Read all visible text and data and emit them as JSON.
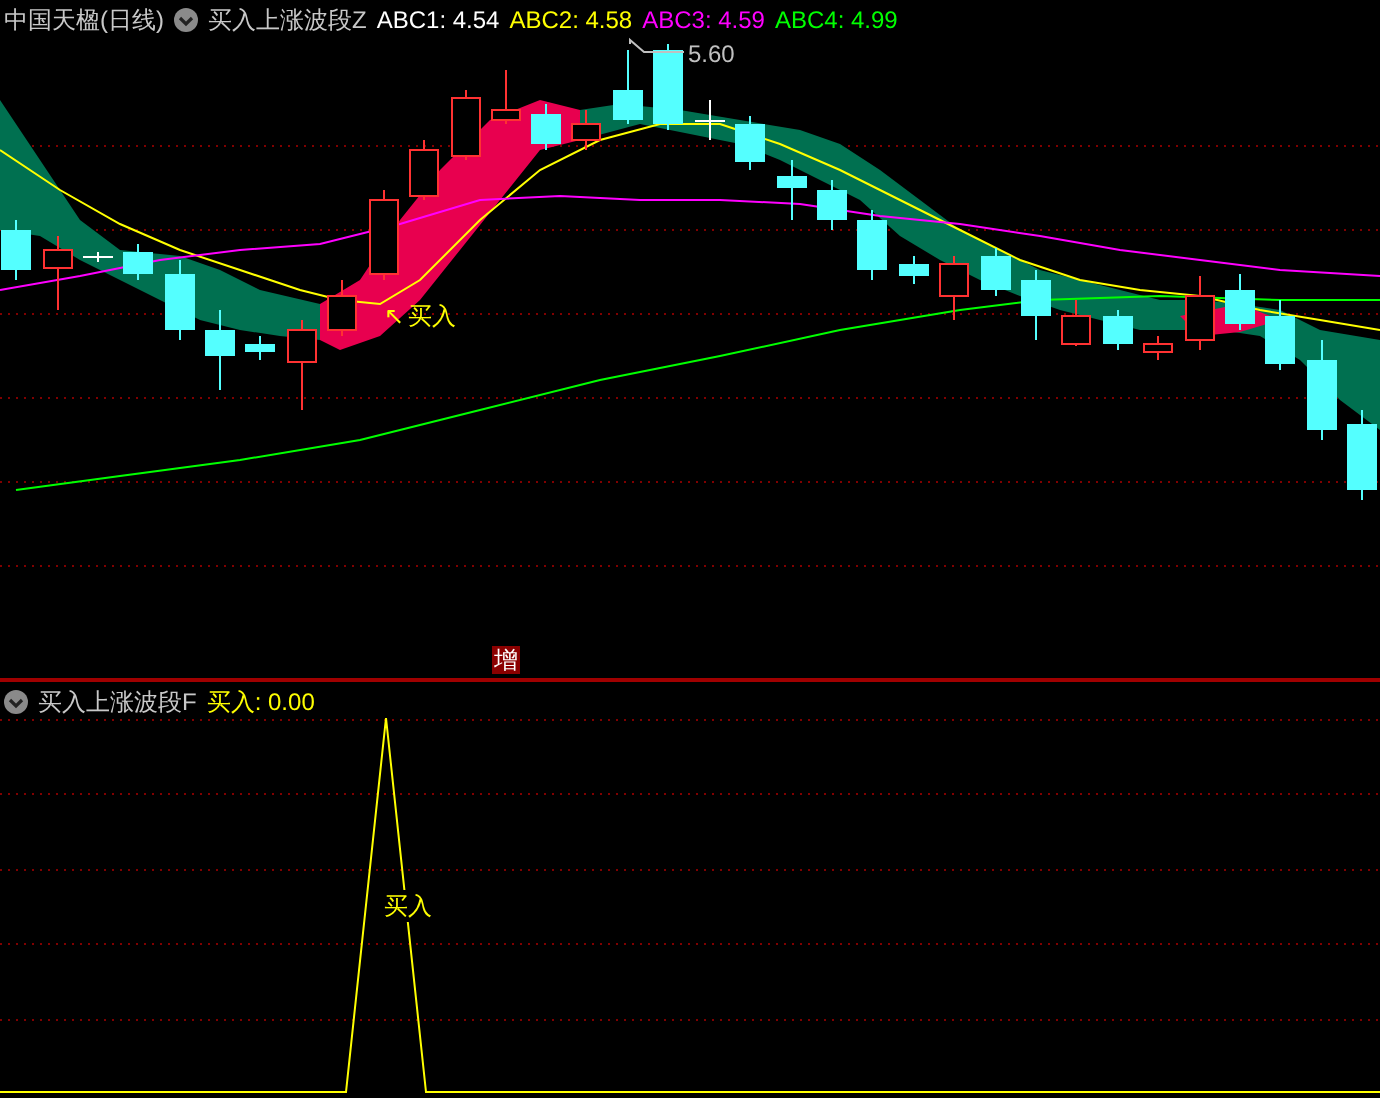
{
  "main_panel": {
    "title": "中国天楹(日线)",
    "indicator": "买入上涨波段Z",
    "values": [
      {
        "label": "ABC1:",
        "value": "4.54",
        "color": "#ffffff"
      },
      {
        "label": "ABC2:",
        "value": "4.58",
        "color": "#ffff00"
      },
      {
        "label": "ABC3:",
        "value": "4.59",
        "color": "#ff00ff"
      },
      {
        "label": "ABC4:",
        "value": "4.99",
        "color": "#00ff00"
      }
    ],
    "peak_label": "5.60",
    "buy_arrow": "↖",
    "buy_label": "买入",
    "badge": "增"
  },
  "lower_panel": {
    "indicator": "买入上涨波段F",
    "values": [
      {
        "label": "买入:",
        "value": "0.00",
        "color": "#ffff00"
      }
    ],
    "signal_label": "买入"
  }
}
